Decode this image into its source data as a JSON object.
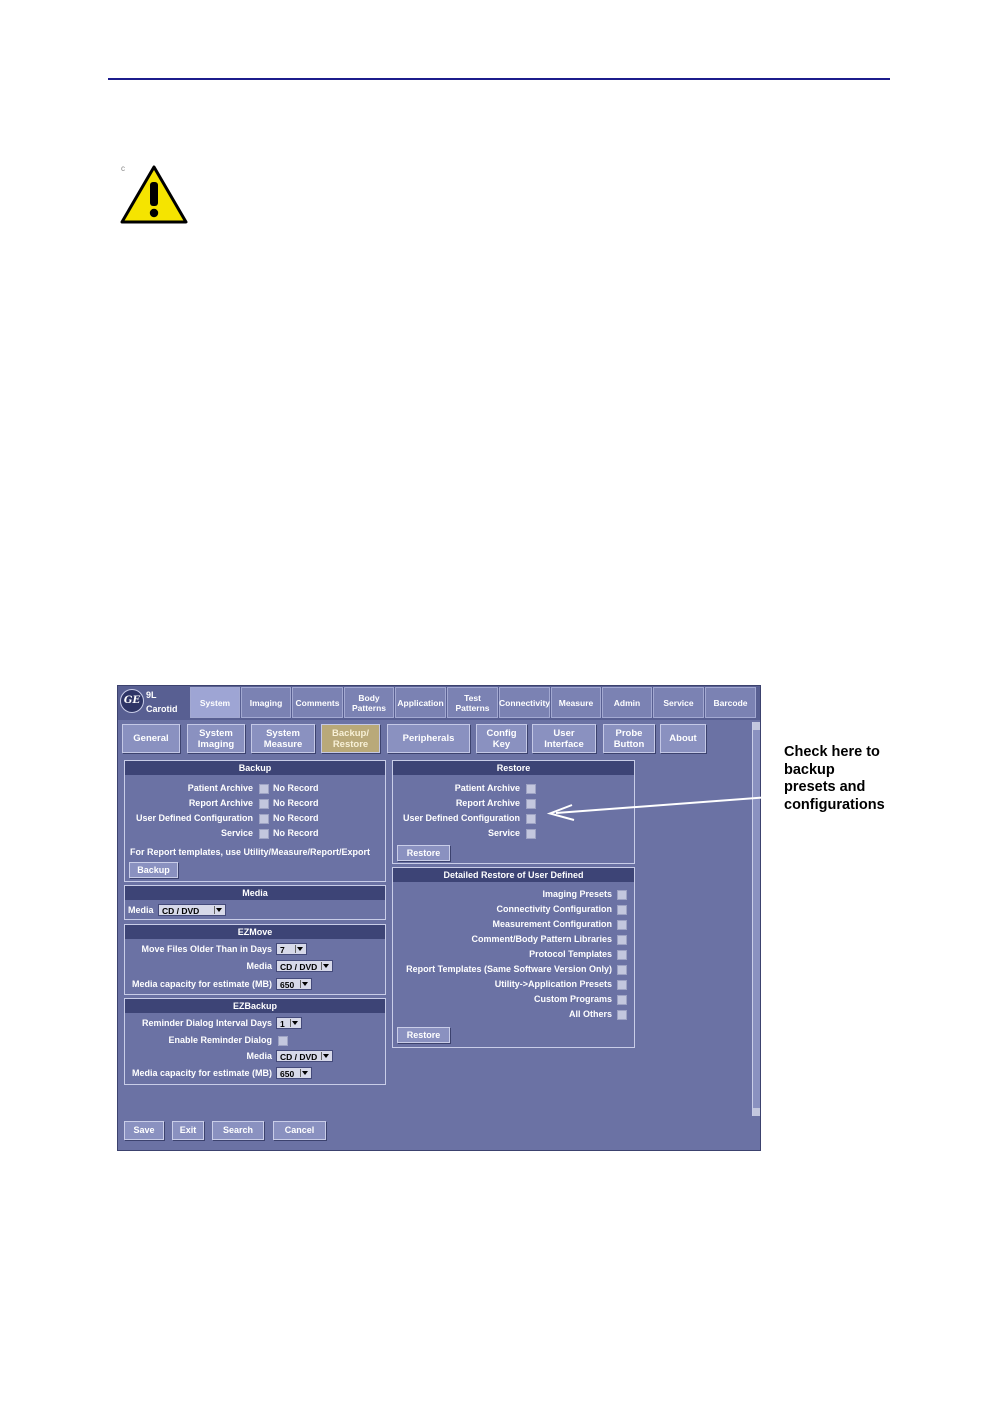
{
  "warning_icon": "warning-triangle-icon",
  "note_glyph": "c",
  "header": {
    "model_line1": "9L",
    "model_line2": "Carotid",
    "logo_icon": "ge-logo-icon",
    "logo_text": "GE",
    "tabs": [
      {
        "label": "System",
        "active": true
      },
      {
        "label": "Imaging"
      },
      {
        "label": "Comments"
      },
      {
        "label": "Body\nPatterns"
      },
      {
        "label": "Application"
      },
      {
        "label": "Test\nPatterns"
      },
      {
        "label": "Connectivity"
      },
      {
        "label": "Measure"
      },
      {
        "label": "Admin"
      },
      {
        "label": "Service"
      },
      {
        "label": "Barcode"
      }
    ]
  },
  "subtabs": [
    {
      "label": "General"
    },
    {
      "label": "System\nImaging"
    },
    {
      "label": "System\nMeasure"
    },
    {
      "label": "Backup/\nRestore",
      "active": true
    },
    {
      "label": "Peripherals"
    },
    {
      "label": "Config\nKey"
    },
    {
      "label": "User\nInterface"
    },
    {
      "label": "Probe\nButton"
    },
    {
      "label": "About"
    }
  ],
  "backup": {
    "title": "Backup",
    "rows": [
      {
        "label": "Patient Archive",
        "status": "No Record"
      },
      {
        "label": "Report Archive",
        "status": "No Record"
      },
      {
        "label": "User Defined Configuration",
        "status": "No Record"
      },
      {
        "label": "Service",
        "status": "No Record"
      }
    ],
    "note": "For Report templates, use Utility/Measure/Report/Export",
    "button": "Backup"
  },
  "media": {
    "title": "Media",
    "label": "Media",
    "value": "CD / DVD"
  },
  "ezmove": {
    "title": "EZMove",
    "days_label": "Move Files Older Than in Days",
    "days_value": "7",
    "media_label": "Media",
    "media_value": "CD / DVD",
    "capacity_label": "Media capacity for estimate (MB)",
    "capacity_value": "650"
  },
  "ezbackup": {
    "title": "EZBackup",
    "interval_label": "Reminder Dialog Interval Days",
    "interval_value": "1",
    "enable_label": "Enable Reminder Dialog",
    "media_label": "Media",
    "media_value": "CD / DVD",
    "capacity_label": "Media capacity for estimate (MB)",
    "capacity_value": "650"
  },
  "restore": {
    "title": "Restore",
    "rows": [
      "Patient Archive",
      "Report Archive",
      "User Defined Configuration",
      "Service"
    ],
    "button": "Restore"
  },
  "detailed_restore": {
    "title": "Detailed Restore of User Defined",
    "rows": [
      "Imaging Presets",
      "Connectivity Configuration",
      "Measurement Configuration",
      "Comment/Body Pattern Libraries",
      "Protocol Templates",
      "Report Templates (Same Software Version Only)",
      "Utility->Application Presets",
      "Custom Programs",
      "All Others"
    ],
    "button": "Restore"
  },
  "bottom_buttons": [
    "Save",
    "Exit",
    "Search",
    "Cancel"
  ],
  "callout": [
    "Check here to",
    "backup",
    "presets and",
    "configurations"
  ],
  "colors": {
    "rule": "#1c1c8c",
    "ui_background": "#6b72a4",
    "panel_header": "#3d4476",
    "active_subtab": "#b9a979",
    "warning_yellow": "#f5e400"
  }
}
